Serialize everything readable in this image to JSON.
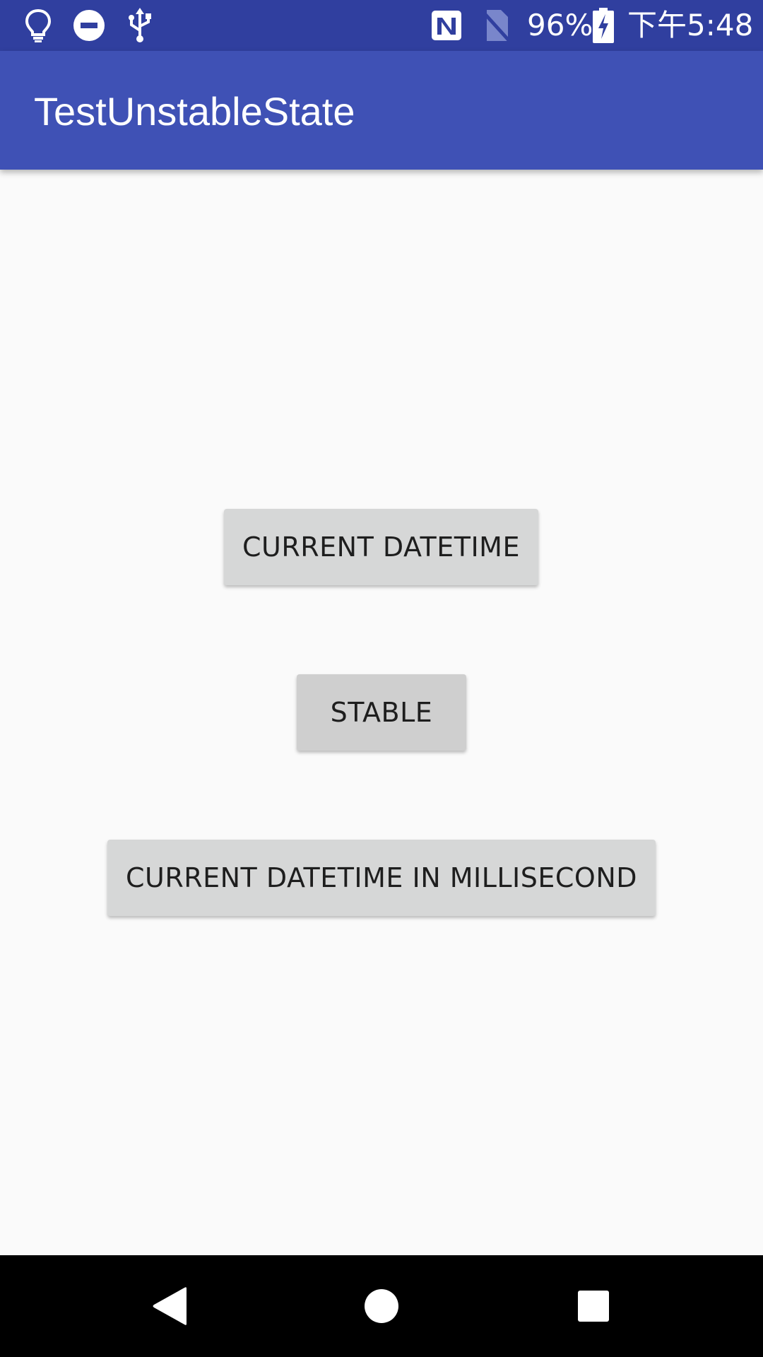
{
  "status_bar": {
    "icons_left": [
      "lightbulb-icon",
      "do-not-disturb-icon",
      "usb-icon"
    ],
    "icons_right": [
      "nfc-icon",
      "no-sim-icon",
      "battery-charging-icon"
    ],
    "battery": "96%",
    "time": "下午5:48"
  },
  "app_bar": {
    "title": "TestUnstableState",
    "color": "#3F51B5"
  },
  "buttons": {
    "current_datetime": "CURRENT DATETIME",
    "stable": "STABLE",
    "current_datetime_ms": "CURRENT DATETIME IN MILLISECOND"
  },
  "nav_bar": {
    "items": [
      "back-icon",
      "home-icon",
      "recents-icon"
    ]
  },
  "colors": {
    "status_bar": "#303F9F",
    "primary": "#3F51B5",
    "background": "#FAFAFA",
    "button": "#D6D7D7"
  }
}
